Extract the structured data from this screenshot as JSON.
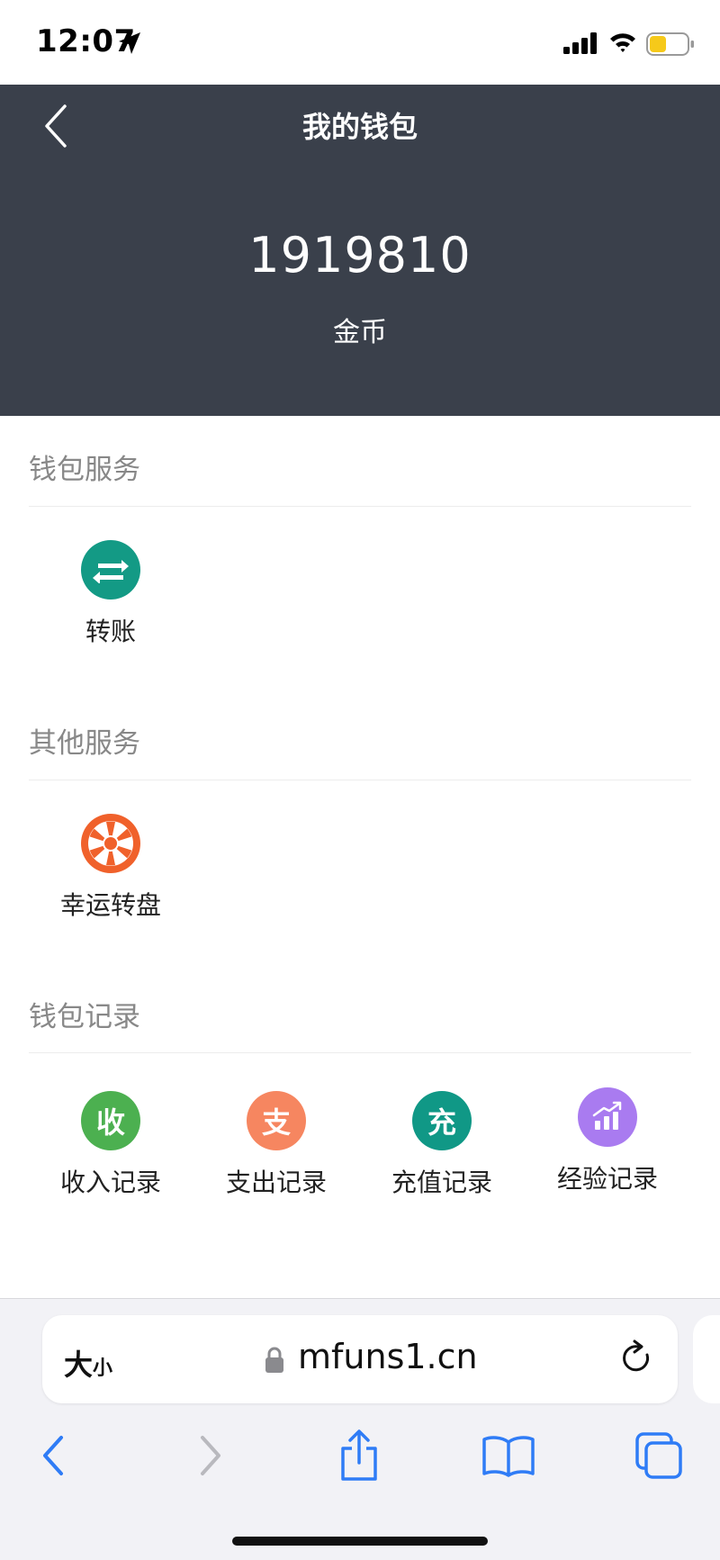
{
  "status_bar": {
    "time": "12:07"
  },
  "header": {
    "title": "我的钱包",
    "balance": "1919810",
    "balance_unit": "金币"
  },
  "sections": {
    "wallet_services": {
      "title": "钱包服务",
      "items": [
        {
          "label": "转账",
          "icon": "transfer-icon",
          "color": "#139a85"
        }
      ]
    },
    "other_services": {
      "title": "其他服务",
      "items": [
        {
          "label": "幸运转盘",
          "icon": "lucky-wheel-icon",
          "color": "#f0612b"
        }
      ]
    },
    "wallet_records": {
      "title": "钱包记录",
      "items": [
        {
          "label": "收入记录",
          "char": "收",
          "icon": "income-icon",
          "color": "#4cb050"
        },
        {
          "label": "支出记录",
          "char": "支",
          "icon": "expense-icon",
          "color": "#f68660"
        },
        {
          "label": "充值记录",
          "char": "充",
          "icon": "recharge-icon",
          "color": "#109886"
        },
        {
          "label": "经验记录",
          "icon": "experience-chart-icon",
          "color": "#a97bf0"
        }
      ]
    }
  },
  "browser": {
    "text_size_big": "大",
    "text_size_small": "小",
    "url": "mfuns1.cn"
  },
  "colors": {
    "header_bg": "#3a404b",
    "ios_blue": "#2f7cf6",
    "battery": "#f6c91a"
  }
}
